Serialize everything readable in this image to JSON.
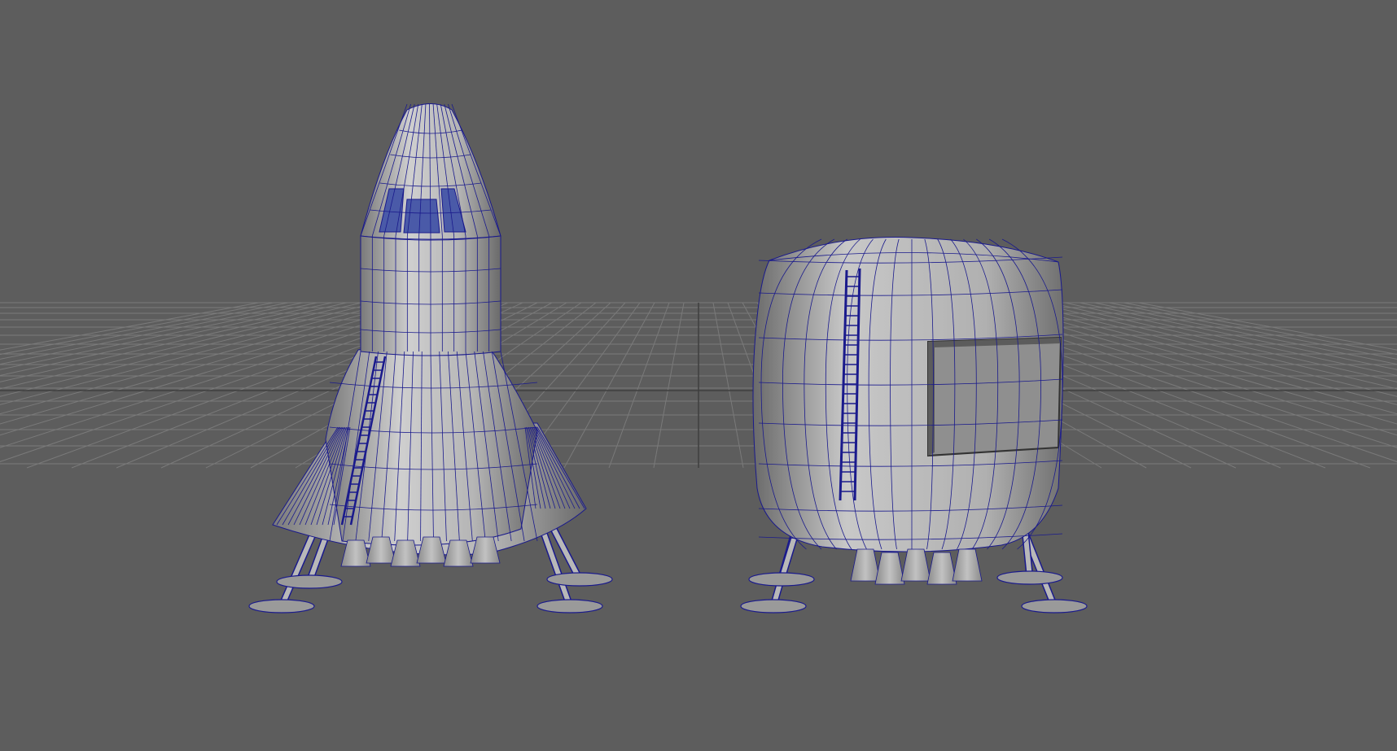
{
  "viewport": {
    "mode": "perspective",
    "display": "wireframe-on-shaded",
    "grid_visible": true
  },
  "colors": {
    "background": "#5d5d5d",
    "grid": "#7a7a7a",
    "grid_dark": "#4a4a4a",
    "shade_light": "#c9c9c9",
    "shade_mid": "#a6a6a6",
    "shade_dark": "#6e6e6e",
    "wire": "#1a1a8c",
    "window": "#4a5aa8"
  },
  "objects": [
    {
      "name": "rocket-lander",
      "type": "mesh"
    },
    {
      "name": "capsule-habitat",
      "type": "mesh"
    }
  ]
}
